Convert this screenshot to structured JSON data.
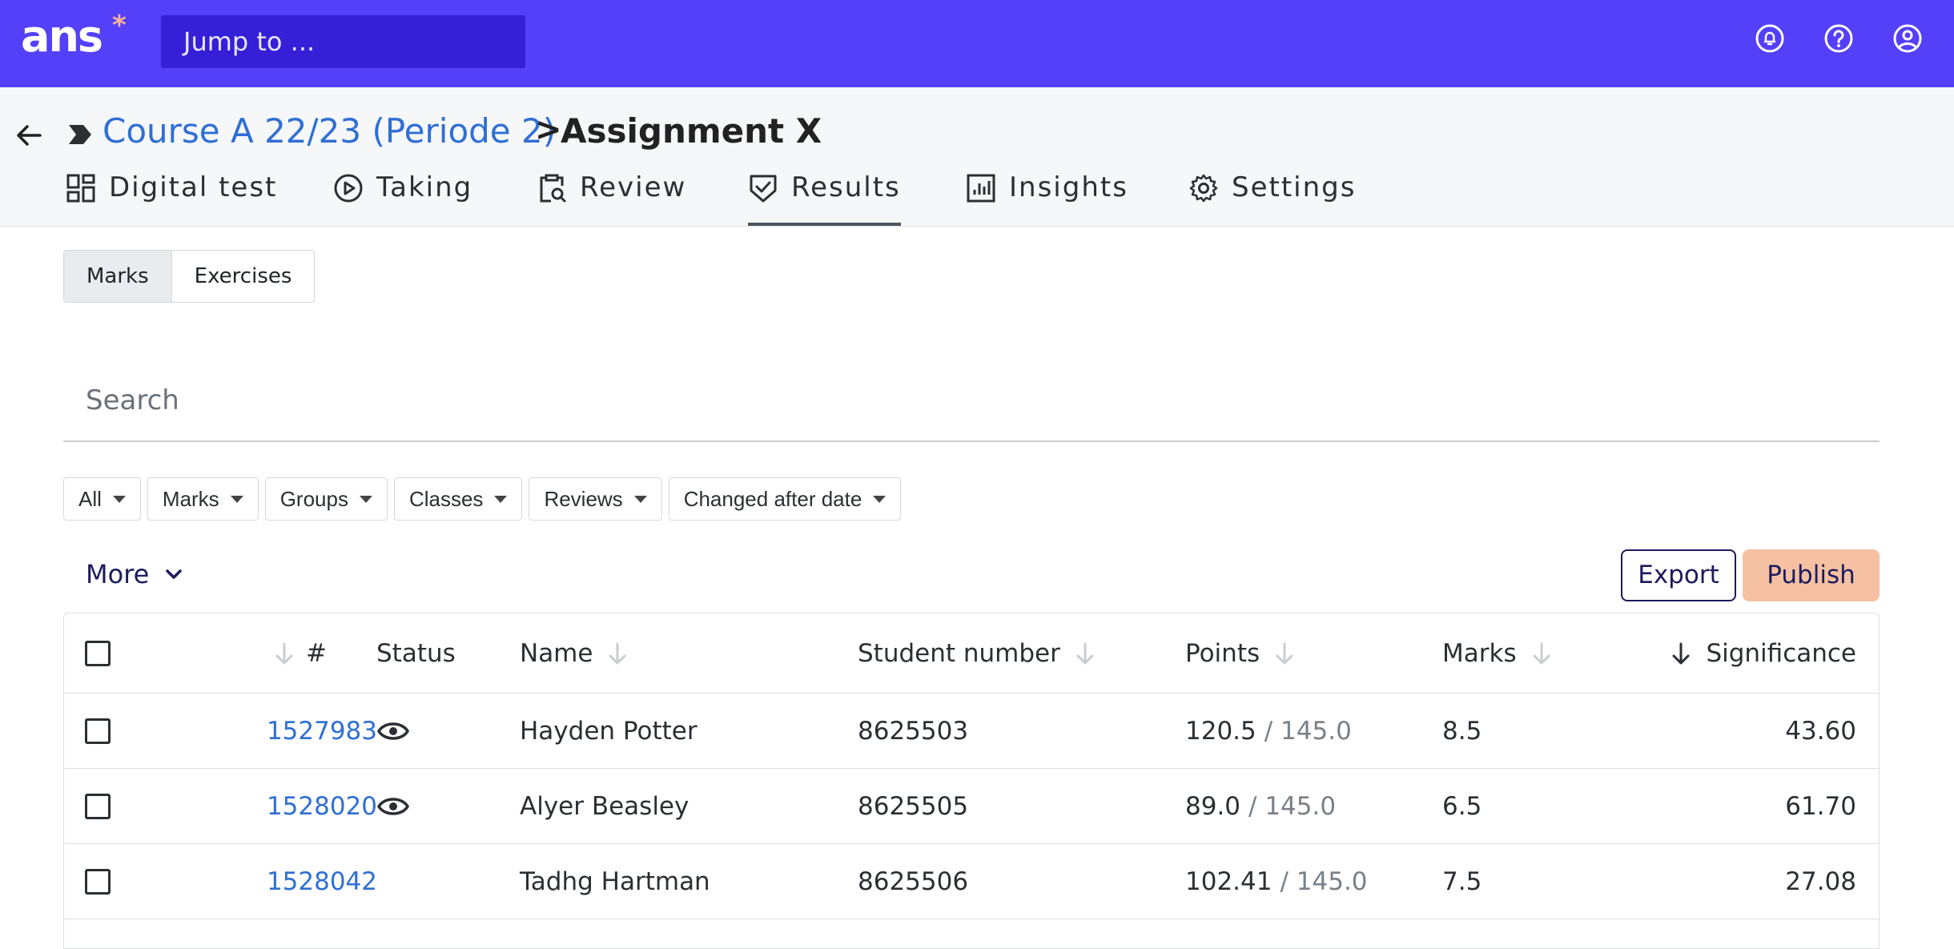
{
  "topbar": {
    "logo": "ans",
    "logo_star": "*",
    "jump_placeholder": "Jump to ...",
    "icons": [
      "notification-bell-icon",
      "help-icon",
      "account-icon"
    ]
  },
  "breadcrumb": {
    "course": "Course A 22/23 (Periode 2)",
    "separator": ">",
    "title": "Assignment X"
  },
  "tabs": [
    {
      "label": "Digital test",
      "icon": "dashboard-icon"
    },
    {
      "label": "Taking",
      "icon": "play-circle-icon"
    },
    {
      "label": "Review",
      "icon": "clipboard-search-icon"
    },
    {
      "label": "Results",
      "icon": "shield-check-icon",
      "active": true
    },
    {
      "label": "Insights",
      "icon": "bar-chart-icon"
    },
    {
      "label": "Settings",
      "icon": "gear-icon"
    }
  ],
  "view_toggle": {
    "marks": "Marks",
    "exercises": "Exercises",
    "selected": "Marks"
  },
  "search": {
    "placeholder": "Search"
  },
  "filters": [
    "All",
    "Marks",
    "Groups",
    "Classes",
    "Reviews",
    "Changed after date"
  ],
  "actions": {
    "more": "More",
    "export": "Export",
    "publish": "Publish"
  },
  "table": {
    "columns": {
      "id": "#",
      "status": "Status",
      "name": "Name",
      "student_number": "Student number",
      "points": "Points",
      "marks": "Marks",
      "significance": "Significance"
    },
    "rows": [
      {
        "id": "1527983",
        "status": "eye-icon",
        "name": "Hayden Potter",
        "student_number": "8625503",
        "points": "120.5",
        "points_max": "/ 145.0",
        "marks": "8.5",
        "significance": "43.60"
      },
      {
        "id": "1528020",
        "status": "eye-icon",
        "name": "Alyer Beasley",
        "student_number": "8625505",
        "points": "89.0",
        "points_max": "/ 145.0",
        "marks": "6.5",
        "significance": "61.70"
      },
      {
        "id": "1528042",
        "status": "",
        "name": "Tadhg Hartman",
        "student_number": "8625506",
        "points": "102.41",
        "points_max": "/ 145.0",
        "marks": "7.5",
        "significance": "27.08"
      }
    ]
  },
  "colors": {
    "brand": "#5440f8",
    "link": "#2f6fd4",
    "publish": "#f5c1a2",
    "dark_text": "#1d1a5c"
  }
}
